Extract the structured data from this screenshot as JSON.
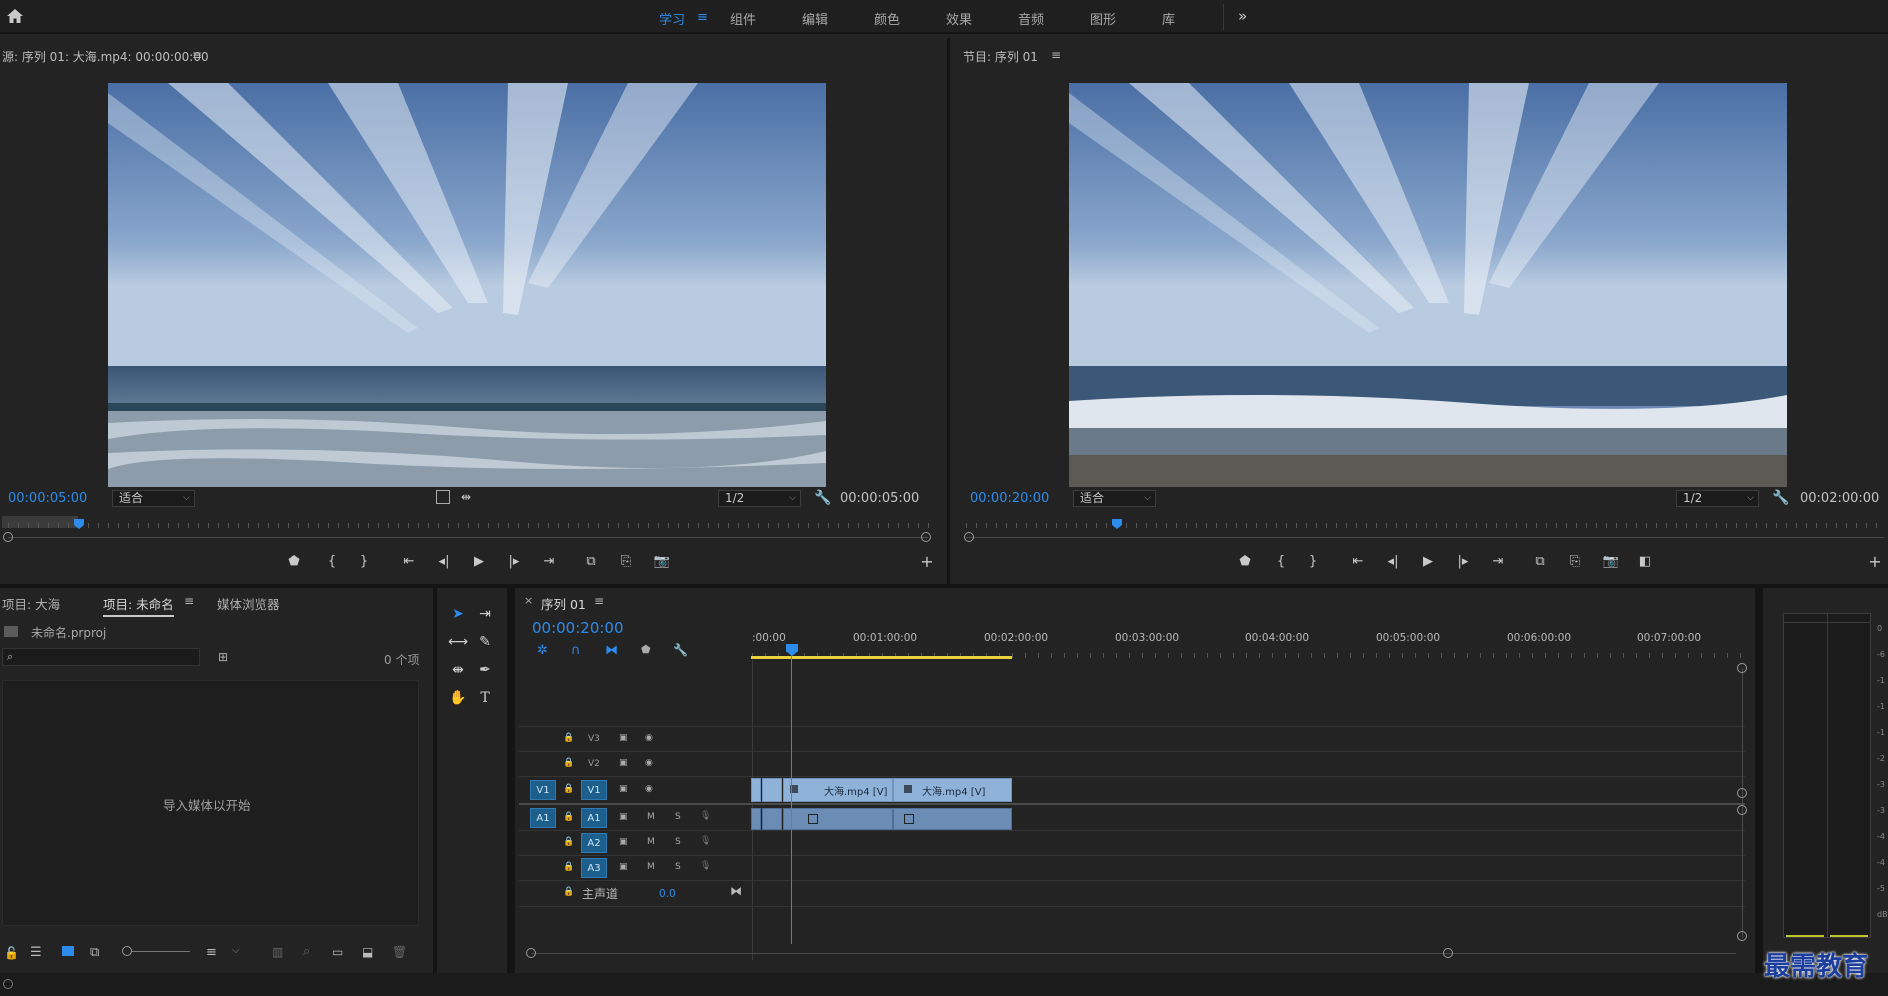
{
  "topbar": {
    "workspaces": [
      "学习",
      "组件",
      "编辑",
      "颜色",
      "效果",
      "音频",
      "图形",
      "库"
    ],
    "active_workspace": "学习",
    "more_label": "»"
  },
  "source_monitor": {
    "title": "源: 序列 01: 大海.mp4: 00:00:00:00",
    "timecode": "00:00:05:00",
    "fit": "适合",
    "resolution": "1/2",
    "duration": "00:00:05:00"
  },
  "program_monitor": {
    "title": "节目: 序列 01",
    "timecode": "00:00:20:00",
    "fit": "适合",
    "resolution": "1/2",
    "duration": "00:02:00:00"
  },
  "project_panel": {
    "tabs": [
      "项目: 大海",
      "项目: 未命名",
      "媒体浏览器"
    ],
    "active_tab": "项目: 未命名",
    "file_name": "未命名.prproj",
    "item_count": "0 个项",
    "empty_hint": "导入媒体以开始"
  },
  "timeline": {
    "sequence_name": "序列 01",
    "timecode": "00:00:20:00",
    "ruler_labels": [
      ":00:00",
      "00:01:00:00",
      "00:02:00:00",
      "00:03:00:00",
      "00:04:00:00",
      "00:05:00:00",
      "00:06:00:00",
      "00:07:00:00"
    ],
    "video_tracks": [
      "V3",
      "V2",
      "V1"
    ],
    "audio_tracks": [
      "A1",
      "A2",
      "A3"
    ],
    "source_patch_video": "V1",
    "source_patch_audio": "A1",
    "mute_label": "M",
    "solo_label": "S",
    "master_label": "主声道",
    "master_value": "0.0",
    "clips": [
      "大海.mp4 [V]",
      "大海.mp4 [V]"
    ]
  },
  "watermark": "最需教育",
  "meter_scale": [
    "0",
    "-6",
    "-1",
    "-1",
    "-1",
    "-2",
    "-3",
    "-3",
    "-4",
    "-4",
    "-5",
    "dB"
  ]
}
